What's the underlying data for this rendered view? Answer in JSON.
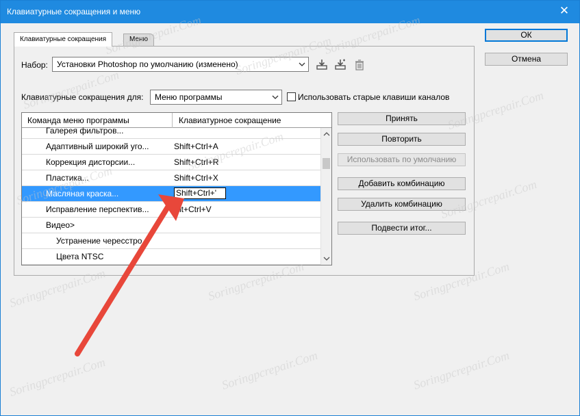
{
  "window": {
    "title": "Клавиатурные сокращения и меню",
    "close_glyph": "✕"
  },
  "tabs": [
    {
      "label": "Клавиатурные сокращения"
    },
    {
      "label": "Меню"
    }
  ],
  "set": {
    "label": "Набор:",
    "value": "Установки Photoshop по умолчанию (изменено)"
  },
  "shortcuts_for": {
    "label": "Клавиатурные сокращения для:",
    "value": "Меню программы",
    "legacy_channels_label": "Использовать старые клавиши каналов",
    "legacy_checked": false
  },
  "table": {
    "headers": [
      "Команда меню программы",
      "Клавиатурное сокращение"
    ],
    "rows": [
      {
        "command": "Галерея фильтров...",
        "shortcut": "",
        "indent": 1
      },
      {
        "command": "Адаптивный широкий уго...",
        "shortcut": "Shift+Ctrl+A",
        "indent": 1
      },
      {
        "command": "Коррекция дисторсии...",
        "shortcut": "Shift+Ctrl+R",
        "indent": 1
      },
      {
        "command": "Пластика...",
        "shortcut": "Shift+Ctrl+X",
        "indent": 1
      },
      {
        "command": "Масляная краска...",
        "shortcut": "Shift+Ctrl+'",
        "indent": 1,
        "selected": true,
        "editing": true
      },
      {
        "command": "Исправление перспектив...",
        "shortcut": "Alt+Ctrl+V",
        "indent": 1
      },
      {
        "command": "Видео>",
        "shortcut": "",
        "indent": 1
      },
      {
        "command": "Устранение чересстро...",
        "shortcut": "",
        "indent": 2
      },
      {
        "command": "Цвета NTSC",
        "shortcut": "",
        "indent": 2
      }
    ]
  },
  "buttons": {
    "ok": "ОК",
    "cancel": "Отмена",
    "accept": "Принять",
    "undo": "Повторить",
    "use_default": "Использовать по умолчанию",
    "add_shortcut": "Добавить комбинацию",
    "delete_shortcut": "Удалить комбинацию",
    "summarize": "Подвести итог..."
  },
  "watermark": "Soringpcrepair.Com",
  "colors": {
    "titlebar": "#1f8ae0",
    "selection": "#3399ff",
    "arrow": "#e8473a"
  }
}
